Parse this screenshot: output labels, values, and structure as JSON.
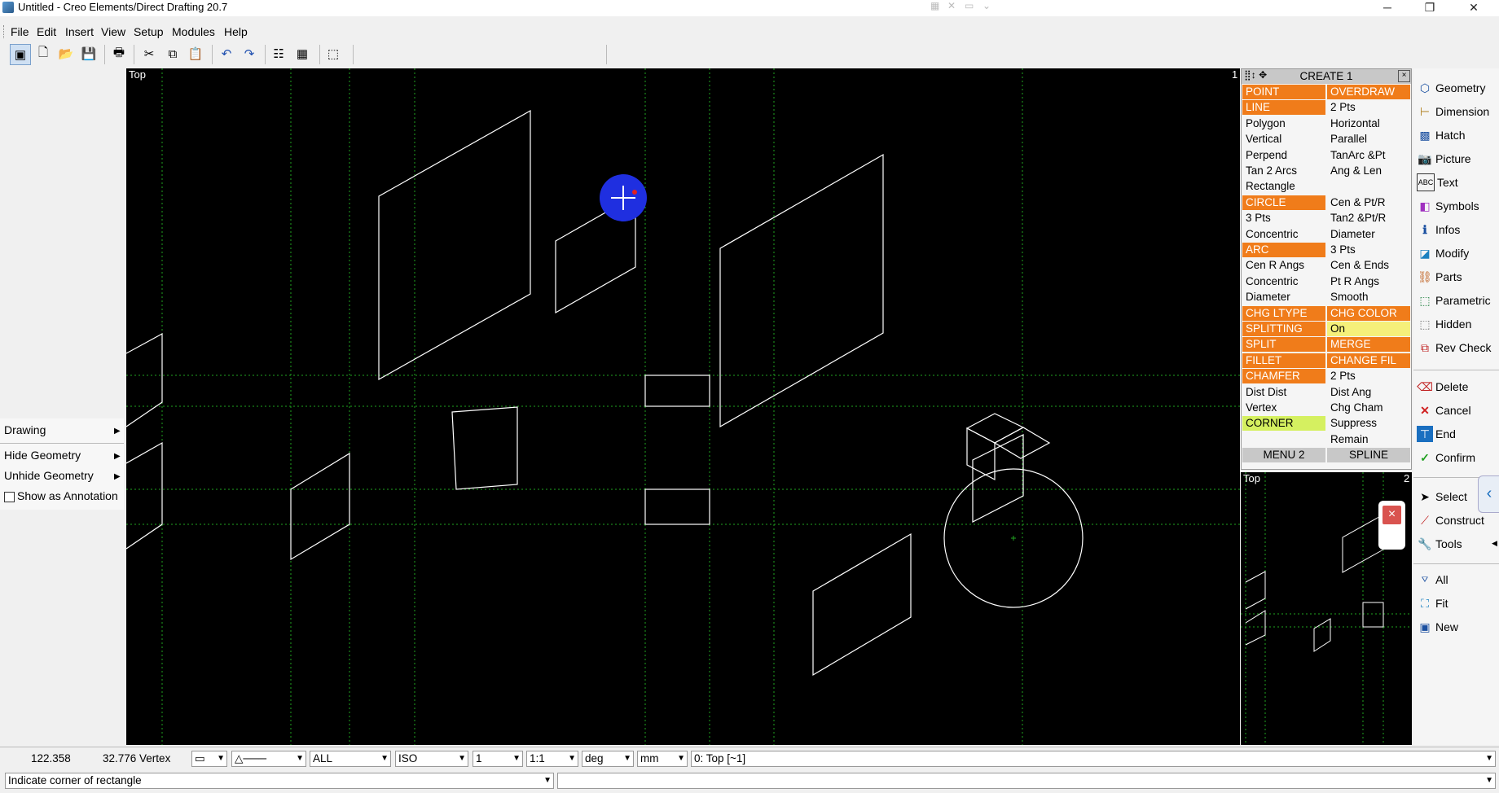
{
  "window": {
    "title": "Untitled - Creo Elements/Direct Drafting 20.7",
    "minimize": "─",
    "restore": "❐",
    "close": "✕"
  },
  "menu": [
    "File",
    "Edit",
    "Insert",
    "View",
    "Setup",
    "Modules",
    "Help"
  ],
  "viewport": {
    "label": "Top",
    "number": "1"
  },
  "subview": {
    "label": "Top",
    "number": "2",
    "close": "×"
  },
  "left_panel": {
    "drawing": "Drawing",
    "hide_geometry": "Hide Geometry",
    "unhide_geometry": "Unhide Geometry",
    "show_as_annotation": "Show as Annotation"
  },
  "create_menu": {
    "title": "CREATE 1",
    "rows": [
      [
        "POINT",
        "OVERDRAW"
      ],
      [
        "LINE",
        "2 Pts"
      ],
      [
        "Polygon",
        "Horizontal"
      ],
      [
        "Vertical",
        "Parallel"
      ],
      [
        "Perpend",
        "TanArc &Pt"
      ],
      [
        "Tan 2 Arcs",
        "Ang & Len"
      ],
      [
        "Rectangle",
        ""
      ],
      [
        "CIRCLE",
        "Cen & Pt/R"
      ],
      [
        "3 Pts",
        "Tan2 &Pt/R"
      ],
      [
        "Concentric",
        "Diameter"
      ],
      [
        "ARC",
        "3 Pts"
      ],
      [
        "Cen R Angs",
        "Cen & Ends"
      ],
      [
        "Concentric",
        "Pt R Angs"
      ],
      [
        "Diameter",
        "Smooth"
      ],
      [
        "CHG LTYPE",
        "CHG COLOR"
      ],
      [
        "SPLITTING",
        "On"
      ],
      [
        "SPLIT",
        "MERGE"
      ],
      [
        "FILLET",
        "CHANGE FIL"
      ],
      [
        "CHAMFER",
        "2 Pts"
      ],
      [
        "Dist Dist",
        "Dist Ang"
      ],
      [
        "Vertex",
        "Chg Cham"
      ],
      [
        "CORNER",
        "Suppress"
      ],
      [
        "",
        "Remain"
      ],
      [
        "MENU 2",
        "SPLINE"
      ]
    ]
  },
  "right_panel": {
    "main": [
      "Geometry",
      "Dimension",
      "Hatch",
      "Picture",
      "Text",
      "Symbols",
      "Infos",
      "Modify",
      "Parts",
      "Parametric",
      "Hidden",
      "Rev Check"
    ],
    "actions": [
      "Delete",
      "Cancel",
      "End",
      "Confirm"
    ],
    "tools": [
      "Select",
      "Construct",
      "Tools"
    ],
    "view": [
      "All",
      "Fit",
      "New"
    ]
  },
  "status": {
    "x": "122.358",
    "y": "32.776 Vertex",
    "layer": "ALL",
    "standard": "ISO",
    "scale_num": "1",
    "scale": "1:1",
    "angle_unit": "deg",
    "length_unit": "mm",
    "view": "0: Top [~1]",
    "prompt": "Indicate corner of rectangle"
  },
  "colors": {
    "orange": "#f07c1a",
    "grid": "#1fa51f",
    "geometry": "#ffffff",
    "cursor": "#1f2fe0"
  }
}
